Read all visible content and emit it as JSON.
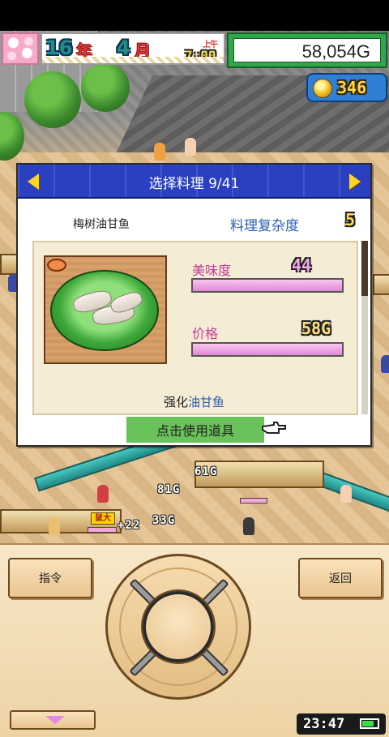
{
  "hud": {
    "year_num": "16",
    "year_unit": "年",
    "month_num": "4",
    "month_unit": "月",
    "ampm": "上午",
    "time": "7:00",
    "money": "58,054G",
    "medals": "346"
  },
  "dialog": {
    "title": "选择料理 9/41",
    "dish_name": "梅树油甘鱼",
    "complexity_label": "料理复杂度",
    "complexity_value": "5",
    "stats": [
      {
        "label": "美味度",
        "value": "44",
        "level": 1.0
      },
      {
        "label": "价格",
        "value": "58G",
        "level": 1.0
      }
    ],
    "enhance_prefix": "强化",
    "enhance_target": "油甘鱼",
    "use_button": "点击使用道具",
    "scroll_position": 0.0
  },
  "world_tags": {
    "tag1": "61G",
    "tag2": "81G",
    "tag3": "+22",
    "tag4": "33G",
    "name1": "鼠大"
  },
  "controls": {
    "command_button": "指令",
    "back_button": "返回"
  },
  "status": {
    "clock": "23:47",
    "battery_level": 0.75
  },
  "colors": {
    "dialog_header": "#2a40c0",
    "stat_bar": "#e08ad6",
    "money_frame": "#2fa74a",
    "use_button": "#69c25a"
  }
}
